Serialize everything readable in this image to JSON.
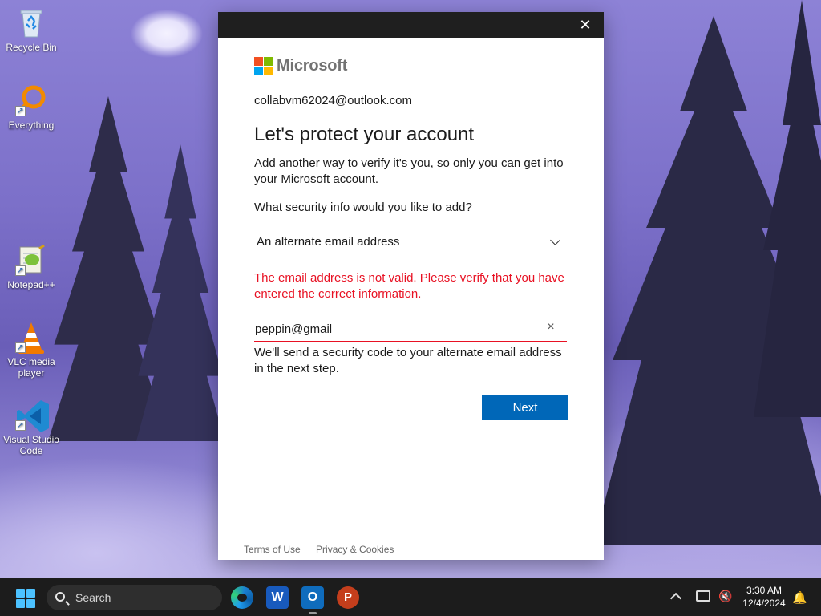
{
  "desktop": {
    "icons": [
      {
        "label": "Recycle Bin"
      },
      {
        "label": "Everything"
      },
      {
        "label": "Notepad++"
      },
      {
        "label": "VLC media player"
      },
      {
        "label": "Visual Studio Code"
      }
    ]
  },
  "dialog": {
    "close_glyph": "✕",
    "brand": "Microsoft",
    "account_email": "collabvm62024@outlook.com",
    "heading": "Let's protect your account",
    "description": "Add another way to verify it's you, so only you can get into your Microsoft account.",
    "question": "What security info would you like to add?",
    "method_select": {
      "selected": "An alternate email address"
    },
    "error_message": "The email address is not valid. Please verify that you have entered the correct information.",
    "email_input": {
      "value": "peppin@gmail"
    },
    "clear_glyph": "×",
    "info_text": "We'll send a security code to your alternate email address in the next step.",
    "next_label": "Next",
    "footer": {
      "terms": "Terms of Use",
      "privacy": "Privacy & Cookies"
    }
  },
  "taskbar": {
    "search_label": "Search",
    "apps": [
      {
        "name": "Microsoft Edge",
        "glyph": ""
      },
      {
        "name": "Microsoft Word",
        "glyph": "W"
      },
      {
        "name": "Outlook",
        "glyph": "O"
      },
      {
        "name": "PowerPoint",
        "glyph": "P"
      }
    ],
    "time": "3:30 AM",
    "date": "12/4/2024"
  },
  "colors": {
    "ms_red": "#f25022",
    "ms_green": "#7fba00",
    "ms_blue": "#00a4ef",
    "ms_yellow": "#ffb900",
    "error_red": "#e81123",
    "next_blue": "#0067b8"
  }
}
